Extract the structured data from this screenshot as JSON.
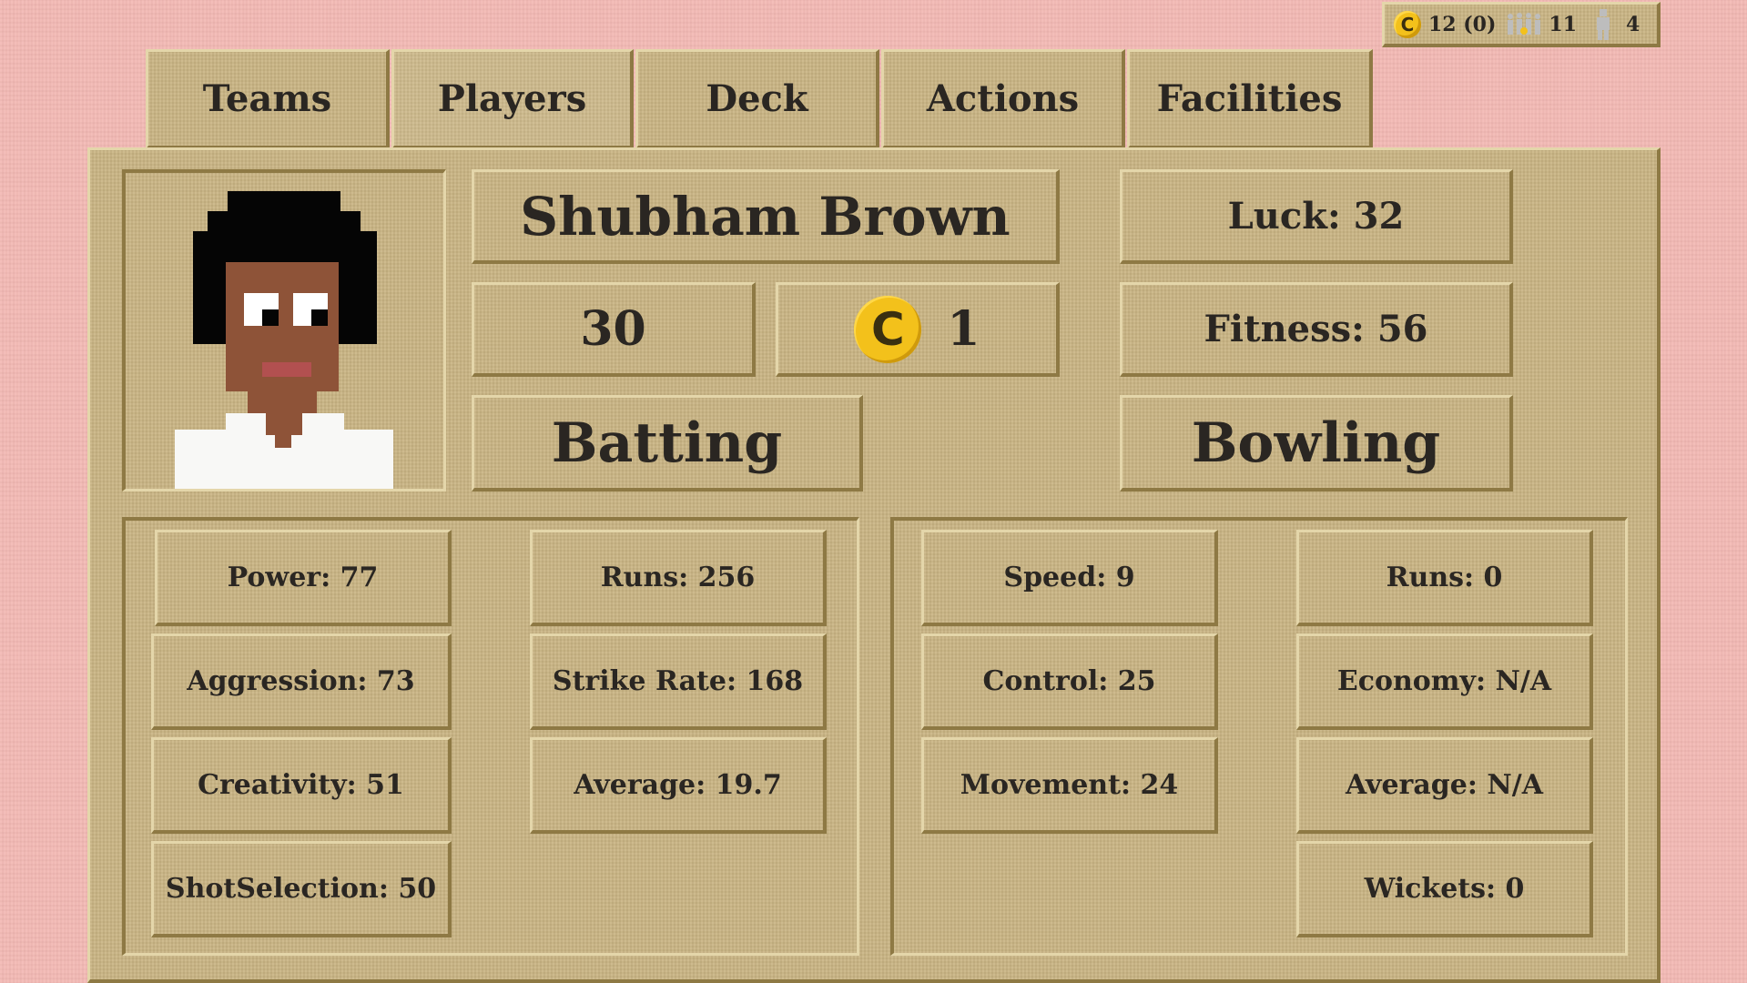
{
  "resources": {
    "coin_icon": "C",
    "coins": "12 (0)",
    "team_count": "11",
    "person_count": "4"
  },
  "tabs": [
    "Teams",
    "Players",
    "Deck",
    "Actions",
    "Facilities"
  ],
  "active_tab": "Players",
  "player": {
    "name": "Shubham Brown",
    "age": "30",
    "coin_icon": "C",
    "cost": "1",
    "luck": "Luck: 32",
    "fitness": "Fitness: 56"
  },
  "sections": {
    "batting": "Batting",
    "bowling": "Bowling"
  },
  "batting_stats": {
    "power": "Power: 77",
    "aggression": "Aggression: 73",
    "creativity": "Creativity: 51",
    "shot_selection": "ShotSelection: 50",
    "runs": "Runs: 256",
    "strike_rate": "Strike Rate: 168",
    "average": "Average: 19.7"
  },
  "bowling_stats": {
    "speed": "Speed: 9",
    "control": "Control: 25",
    "movement": "Movement: 24",
    "runs": "Runs: 0",
    "economy": "Economy: N/A",
    "average": "Average: N/A",
    "wickets": "Wickets: 0"
  },
  "colors": {
    "background": "#f2b8b3",
    "panel": "#c9b483",
    "coin": "#f3c11b",
    "text": "#2a2622"
  }
}
